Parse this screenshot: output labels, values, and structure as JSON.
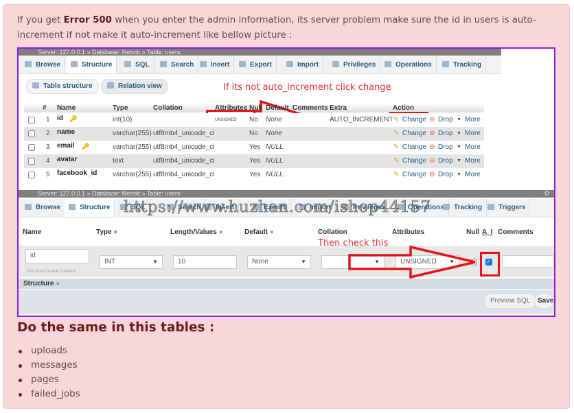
{
  "intro": {
    "prefix": "If you get ",
    "bold": "Error 500",
    "suffix": " when you enter the admin information, its server problem make sure the id in users is auto-increment if not make it auto-increment like bellow picture :"
  },
  "screenshot1": {
    "breadcrumb": "Server: 127.0.0.1 » Database: filebob » Table: users",
    "tabs": [
      "Browse",
      "Structure",
      "SQL",
      "Search",
      "Insert",
      "Export",
      "Import",
      "Privileges",
      "Operations",
      "Tracking"
    ],
    "active_tab": "Structure",
    "subtabs": [
      "Table structure",
      "Relation view"
    ],
    "annotation": "If its not auto_increment click change",
    "columns": [
      "#",
      "Name",
      "Type",
      "Collation",
      "Attributes",
      "Null",
      "Default",
      "Comments",
      "Extra",
      "Action"
    ],
    "rows": [
      {
        "num": "1",
        "name": "id",
        "key": "primary-key-icon",
        "type": "int(10)",
        "collation": "",
        "attributes": "UNSIGNED",
        "null": "No",
        "default": "None",
        "extra": "AUTO_INCREMENT"
      },
      {
        "num": "2",
        "name": "name",
        "key": "",
        "type": "varchar(255)",
        "collation": "utf8mb4_unicode_ci",
        "attributes": "",
        "null": "No",
        "default": "None",
        "extra": ""
      },
      {
        "num": "3",
        "name": "email",
        "key": "unique-key-icon",
        "type": "varchar(255)",
        "collation": "utf8mb4_unicode_ci",
        "attributes": "",
        "null": "Yes",
        "default": "NULL",
        "extra": ""
      },
      {
        "num": "4",
        "name": "avatar",
        "key": "",
        "type": "text",
        "collation": "utf8mb4_unicode_ci",
        "attributes": "",
        "null": "Yes",
        "default": "NULL",
        "extra": ""
      },
      {
        "num": "5",
        "name": "facebook_id",
        "key": "",
        "type": "varchar(255)",
        "collation": "utf8mb4_unicode_ci",
        "attributes": "",
        "null": "Yes",
        "default": "NULL",
        "extra": ""
      }
    ],
    "actions": {
      "change": "Change",
      "drop": "Drop",
      "more": "More"
    }
  },
  "screenshot2": {
    "breadcrumb": "Server: 127.0.0.1 » Database: filebob » Table: users",
    "tabs": [
      "Browse",
      "Structure",
      "SQL",
      "Search",
      "Insert",
      "Export",
      "Import",
      "Privileges",
      "Operations",
      "Tracking",
      "Triggers"
    ],
    "active_tab": "Structure",
    "watermark": "https://www.huzhan.com/ishop44157",
    "headers": {
      "name": "Name",
      "type": "Type",
      "length": "Length/Values",
      "default": "Default",
      "collation": "Collation",
      "attributes": "Attributes",
      "null": "Null",
      "ai": "A_I",
      "comments": "Comments"
    },
    "annotation": "Then check this",
    "field": {
      "name": "id",
      "type": "INT",
      "length": "10",
      "default": "None",
      "collation": "",
      "attributes": "UNSIGNED",
      "null_checked": false,
      "ai_checked": true,
      "comments": ""
    },
    "pick_link": "Pick from Central Columns",
    "structure_label": "Structure",
    "buttons": {
      "preview": "Preview SQL",
      "save": "Save"
    }
  },
  "heading": "Do the same in this tables :",
  "tables": [
    "uploads",
    "messages",
    "pages",
    "failed_jobs"
  ],
  "colors": {
    "alert_bg": "#f8d7da",
    "frame": "#8e1ed6",
    "annotation_red": "#e3131b",
    "link": "#235a81"
  }
}
